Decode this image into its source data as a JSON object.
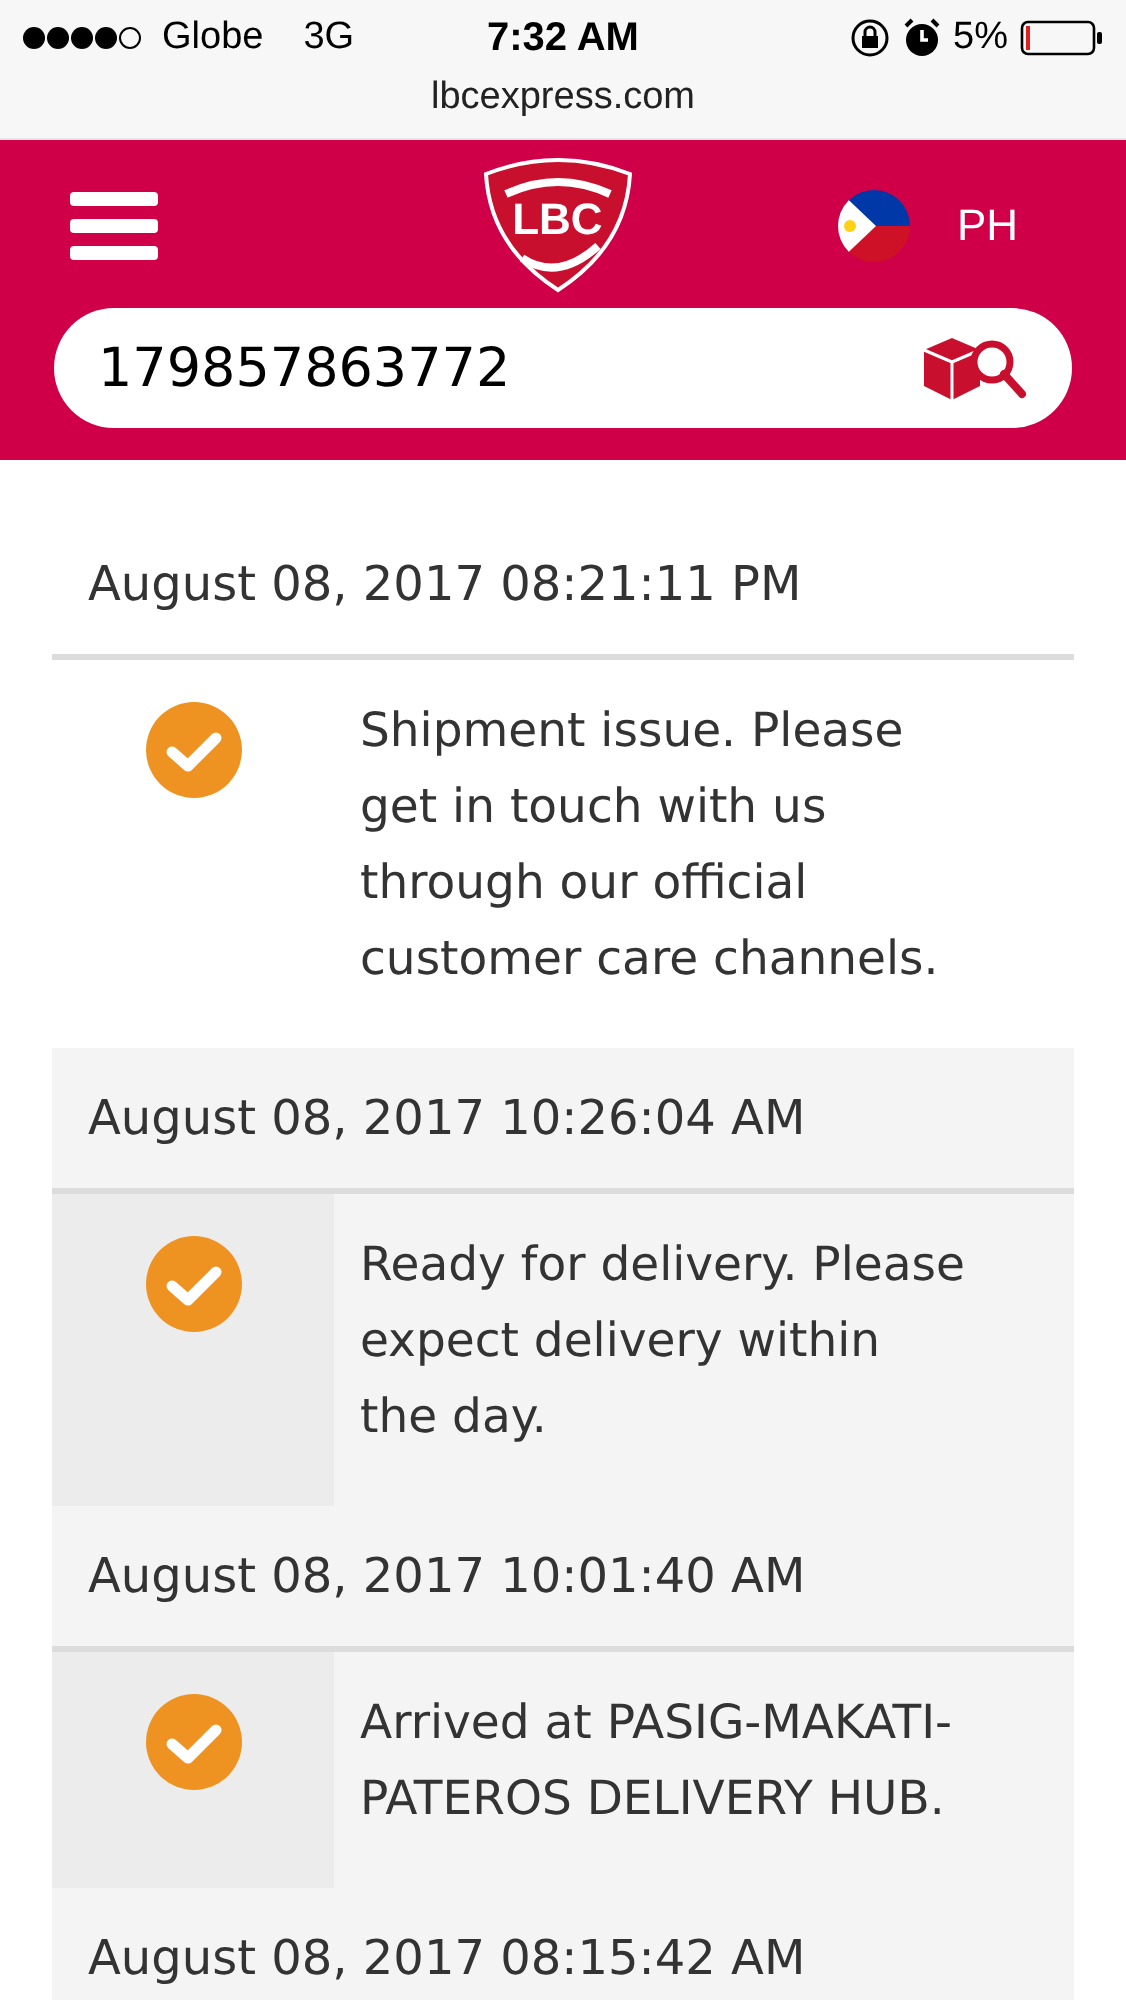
{
  "status_bar": {
    "carrier": "Globe",
    "network": "3G",
    "time": "7:32 AM",
    "battery": "5%"
  },
  "address_bar": {
    "url": "lbcexpress.com"
  },
  "header": {
    "logo": "LBC",
    "region": "PH"
  },
  "search": {
    "value": "179857863772"
  },
  "events": [
    {
      "timestamp": "August 08, 2017 08:21:11 PM",
      "status": "Shipment issue. Please get in touch with us through our official customer care channels.",
      "latest": true
    },
    {
      "timestamp": "August 08, 2017 10:26:04 AM",
      "status": "Ready for delivery. Please expect delivery within the day.",
      "latest": false
    },
    {
      "timestamp": "August 08, 2017 10:01:40 AM",
      "status": "Arrived at PASIG-MAKATI-PATEROS DELIVERY HUB.",
      "latest": false
    },
    {
      "timestamp": "August 08, 2017 08:15:42 AM",
      "latest": false
    }
  ]
}
